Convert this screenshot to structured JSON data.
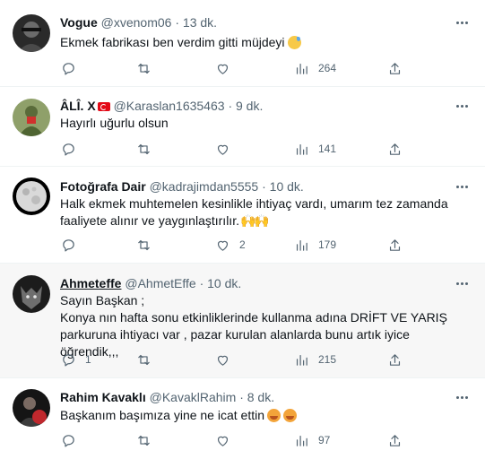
{
  "tweets": [
    {
      "name": "Vogue",
      "handle": "@xvenom06",
      "time": "13 dk.",
      "lines": [
        "Ekmek fabrikası ben verdim gitti müjdeyi"
      ],
      "emoji": "sweat-smile",
      "replies": "",
      "retweets": "",
      "likes": "",
      "views": "264"
    },
    {
      "name": "ÂLÎ. X",
      "handle": "@Karaslan1635463",
      "time": "9 dk.",
      "lines": [
        "Hayırlı uğurlu olsun"
      ],
      "replies": "",
      "retweets": "",
      "likes": "",
      "views": "141"
    },
    {
      "name": "Fotoğrafa Dair",
      "handle": "@kadrajimdan5555",
      "time": "10 dk.",
      "lines": [
        "Halk ekmek muhtemelen kesinlikle ihtiyaç vardı, umarım tez zamanda",
        "faaliyete alınır ve yaygınlaştırılır."
      ],
      "replies": "",
      "retweets": "",
      "likes": "2",
      "views": "179"
    },
    {
      "name": "Ahmeteffe",
      "handle": "@AhmetEffe",
      "time": "10 dk.",
      "lines": [
        "Sayın Başkan ;",
        "Konya nın hafta sonu etkinliklerinde kullanma adına DRİFT VE YARIŞ",
        "parkuruna ihtiyacı var , pazar kurulan alanlarda bunu artık iyice öğrendik,,,"
      ],
      "replies": "1",
      "retweets": "",
      "likes": "",
      "views": "215"
    },
    {
      "name": "Rahim Kavaklı",
      "handle": "@KavaklRahim",
      "time": "8 dk.",
      "lines": [
        "Başkanım başımıza yine ne icat ettin"
      ],
      "replies": "",
      "retweets": "",
      "likes": "",
      "views": "97"
    }
  ],
  "separator": "·"
}
